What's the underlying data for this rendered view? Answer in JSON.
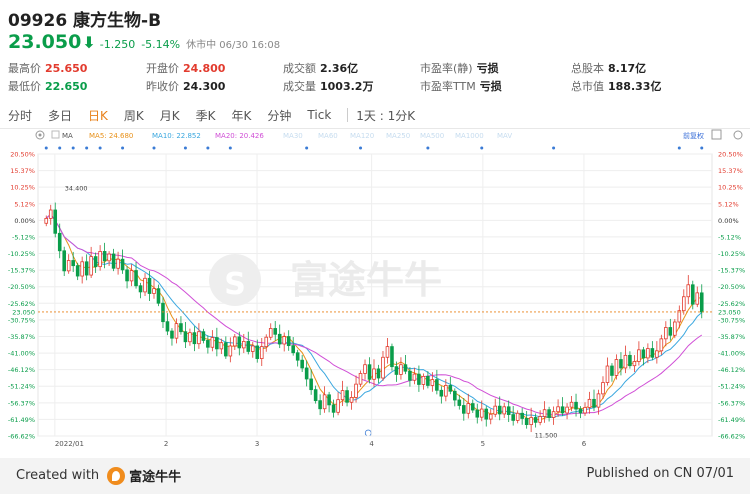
{
  "header": {
    "code_name": "09926 康方生物-B",
    "price": "23.050",
    "change": "-1.250",
    "change_pct": "-5.14%",
    "status": "休市中  06/30 16:08",
    "stats": {
      "high_label": "最高价",
      "high": "25.650",
      "low_label": "最低价",
      "low": "22.650",
      "open_label": "开盘价",
      "open": "24.800",
      "prev_close_label": "昨收价",
      "prev_close": "24.300",
      "turnover_label": "成交额",
      "turnover": "2.36亿",
      "volume_label": "成交量",
      "volume": "1003.2万",
      "pe_static_label": "市盈率(静)",
      "pe_static": "亏损",
      "pe_ttm_label": "市盈率TTM",
      "pe_ttm": "亏损",
      "total_shares_label": "总股本",
      "total_shares": "8.17亿",
      "market_cap_label": "总市值",
      "market_cap": "188.33亿"
    }
  },
  "tabs": [
    "分时",
    "多日",
    "日K",
    "周K",
    "月K",
    "季K",
    "年K",
    "分钟",
    "Tick",
    "1天 : 1分K"
  ],
  "active_tab": "日K",
  "ma_legend": {
    "ma": "MA",
    "ma5": "MA5: 24.680",
    "ma10": "MA10: 22.852",
    "ma20": "MA20: 20.426",
    "ma30": "MA30",
    "ma60": "MA60",
    "ma120": "MA120",
    "ma250": "MA250",
    "ma500": "MA500",
    "ma1000": "MA1000",
    "mav": "MAV",
    "adjust": "前复权",
    "colors": {
      "ma5": "#e8911a",
      "ma10": "#3aa7df",
      "ma20": "#d04fd6",
      "faded": "#c6dcef"
    }
  },
  "footer": {
    "created_with": "Created with",
    "brand": "富途牛牛",
    "published": "Published on CN 07/01"
  },
  "watermark": "富途牛牛",
  "chart_data": {
    "type": "candlestick",
    "y_axis_pct_ticks": [
      "20.50%",
      "15.37%",
      "10.25%",
      "5.12%",
      "0.00%",
      "-5.12%",
      "-10.25%",
      "-15.37%",
      "-20.50%",
      "-25.62%",
      "-30.75%",
      "-35.87%",
      "-41.00%",
      "-46.12%",
      "-51.24%",
      "-56.37%",
      "-61.49%",
      "-66.62%"
    ],
    "y_axis_price_ticks": [
      "20.50%",
      "15.37%",
      "10.25%",
      "5.12%",
      "0.00%",
      "-5.12%",
      "-10.25%",
      "-15.37%",
      "-20.50%",
      "-25.62%",
      "23.050",
      "-30.75%",
      "-35.87%",
      "-41.00%",
      "-46.12%",
      "-51.24%",
      "-56.37%",
      "-61.49%",
      "-66.62%"
    ],
    "x_labels": [
      "2022/01",
      "2",
      "3",
      "4",
      "5",
      "6"
    ],
    "ylim_pct": [
      -66.62,
      20.5
    ],
    "current_price_label": "23.050",
    "current_price_pct": -28.3,
    "max_label": "34.400",
    "min_label": "11.500",
    "colors": {
      "up": "#e23b2e",
      "down": "#0a9d4a",
      "grid": "#eeeeee",
      "price_line": "#e8811a"
    },
    "close_pct": [
      0.6,
      3.2,
      -4.0,
      -9.4,
      -15.6,
      -12.4,
      -14.0,
      -17.2,
      -12.8,
      -16.9,
      -11.2,
      -14.3,
      -9.6,
      -12.5,
      -10.4,
      -14.8,
      -12.0,
      -15.3,
      -18.7,
      -15.5,
      -20.2,
      -22.1,
      -17.9,
      -22.6,
      -21.1,
      -25.6,
      -31.3,
      -34.2,
      -36.4,
      -31.9,
      -34.4,
      -37.5,
      -34.7,
      -38.1,
      -34.4,
      -37.1,
      -39.2,
      -36.2,
      -39.7,
      -37.8,
      -41.9,
      -38.8,
      -36.0,
      -39.4,
      -37.4,
      -40.5,
      -38.8,
      -42.7,
      -39.0,
      -36.1,
      -33.4,
      -35.2,
      -38.2,
      -35.9,
      -38.7,
      -40.9,
      -43.2,
      -45.6,
      -49.0,
      -52.3,
      -55.7,
      -58.2,
      -53.9,
      -57.0,
      -59.3,
      -55.4,
      -52.6,
      -56.2,
      -54.7,
      -50.6,
      -47.3,
      -44.6,
      -49.1,
      -45.9,
      -48.7,
      -42.3,
      -39.0,
      -45.2,
      -47.6,
      -44.6,
      -46.6,
      -49.4,
      -47.5,
      -50.7,
      -48.2,
      -51.0,
      -49.2,
      -52.5,
      -54.3,
      -51.0,
      -52.8,
      -55.5,
      -57.2,
      -59.6,
      -56.6,
      -58.6,
      -60.8,
      -58.3,
      -61.4,
      -59.9,
      -57.4,
      -59.8,
      -57.6,
      -60.0,
      -61.8,
      -59.6,
      -61.2,
      -63.1,
      -60.9,
      -62.4,
      -60.6,
      -58.5,
      -60.9,
      -59.1,
      -57.6,
      -59.5,
      -57.7,
      -56.2,
      -58.3,
      -59.5,
      -57.8,
      -55.3,
      -57.7,
      -53.6,
      -50.1,
      -45.0,
      -47.9,
      -43.0,
      -45.6,
      -41.7,
      -44.9,
      -43.6,
      -40.0,
      -42.5,
      -39.6,
      -42.3,
      -40.3,
      -36.6,
      -33.1,
      -35.5,
      -31.4,
      -27.9,
      -23.6,
      -19.9,
      -25.9,
      -22.4,
      -28.3
    ]
  }
}
